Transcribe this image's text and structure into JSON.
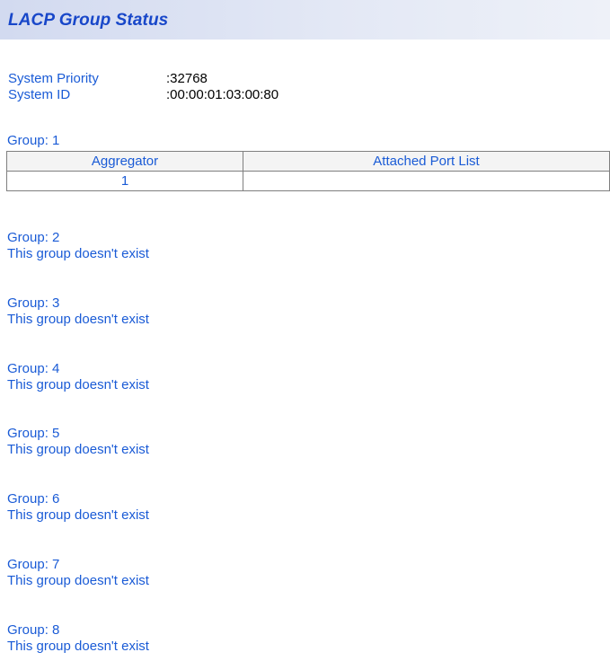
{
  "header": {
    "title": "LACP Group Status"
  },
  "system": {
    "priority_label": "System Priority",
    "priority_value": "32768",
    "id_label": "System ID",
    "id_value": "00:00:01:03:00:80",
    "separator": ":"
  },
  "group1": {
    "label": "Group: 1",
    "columns": [
      "Aggregator",
      "Attached Port List"
    ],
    "rows": [
      {
        "aggregator": "1",
        "ports": ""
      }
    ]
  },
  "groups": [
    {
      "label": "Group: 2",
      "message": "This group doesn't exist"
    },
    {
      "label": "Group: 3",
      "message": "This group doesn't exist"
    },
    {
      "label": "Group: 4",
      "message": "This group doesn't exist"
    },
    {
      "label": "Group: 5",
      "message": "This group doesn't exist"
    },
    {
      "label": "Group: 6",
      "message": "This group doesn't exist"
    },
    {
      "label": "Group: 7",
      "message": "This group doesn't exist"
    },
    {
      "label": "Group: 8",
      "message": "This group doesn't exist"
    }
  ],
  "colors": {
    "text": "#1a5bd6",
    "title": "#1847c9",
    "value": "#000000",
    "header_band": "#d2daf0"
  }
}
